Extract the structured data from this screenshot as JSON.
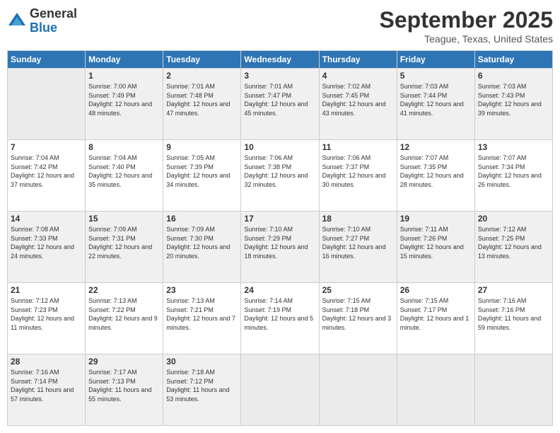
{
  "header": {
    "logo_general": "General",
    "logo_blue": "Blue",
    "month_title": "September 2025",
    "location": "Teague, Texas, United States"
  },
  "days_of_week": [
    "Sunday",
    "Monday",
    "Tuesday",
    "Wednesday",
    "Thursday",
    "Friday",
    "Saturday"
  ],
  "weeks": [
    [
      {
        "day": "",
        "empty": true
      },
      {
        "day": "1",
        "sunrise": "7:00 AM",
        "sunset": "7:49 PM",
        "daylight": "12 hours and 48 minutes."
      },
      {
        "day": "2",
        "sunrise": "7:01 AM",
        "sunset": "7:48 PM",
        "daylight": "12 hours and 47 minutes."
      },
      {
        "day": "3",
        "sunrise": "7:01 AM",
        "sunset": "7:47 PM",
        "daylight": "12 hours and 45 minutes."
      },
      {
        "day": "4",
        "sunrise": "7:02 AM",
        "sunset": "7:45 PM",
        "daylight": "12 hours and 43 minutes."
      },
      {
        "day": "5",
        "sunrise": "7:03 AM",
        "sunset": "7:44 PM",
        "daylight": "12 hours and 41 minutes."
      },
      {
        "day": "6",
        "sunrise": "7:03 AM",
        "sunset": "7:43 PM",
        "daylight": "12 hours and 39 minutes."
      }
    ],
    [
      {
        "day": "7",
        "sunrise": "7:04 AM",
        "sunset": "7:42 PM",
        "daylight": "12 hours and 37 minutes."
      },
      {
        "day": "8",
        "sunrise": "7:04 AM",
        "sunset": "7:40 PM",
        "daylight": "12 hours and 35 minutes."
      },
      {
        "day": "9",
        "sunrise": "7:05 AM",
        "sunset": "7:39 PM",
        "daylight": "12 hours and 34 minutes."
      },
      {
        "day": "10",
        "sunrise": "7:06 AM",
        "sunset": "7:38 PM",
        "daylight": "12 hours and 32 minutes."
      },
      {
        "day": "11",
        "sunrise": "7:06 AM",
        "sunset": "7:37 PM",
        "daylight": "12 hours and 30 minutes."
      },
      {
        "day": "12",
        "sunrise": "7:07 AM",
        "sunset": "7:35 PM",
        "daylight": "12 hours and 28 minutes."
      },
      {
        "day": "13",
        "sunrise": "7:07 AM",
        "sunset": "7:34 PM",
        "daylight": "12 hours and 26 minutes."
      }
    ],
    [
      {
        "day": "14",
        "sunrise": "7:08 AM",
        "sunset": "7:33 PM",
        "daylight": "12 hours and 24 minutes."
      },
      {
        "day": "15",
        "sunrise": "7:09 AM",
        "sunset": "7:31 PM",
        "daylight": "12 hours and 22 minutes."
      },
      {
        "day": "16",
        "sunrise": "7:09 AM",
        "sunset": "7:30 PM",
        "daylight": "12 hours and 20 minutes."
      },
      {
        "day": "17",
        "sunrise": "7:10 AM",
        "sunset": "7:29 PM",
        "daylight": "12 hours and 18 minutes."
      },
      {
        "day": "18",
        "sunrise": "7:10 AM",
        "sunset": "7:27 PM",
        "daylight": "12 hours and 16 minutes."
      },
      {
        "day": "19",
        "sunrise": "7:11 AM",
        "sunset": "7:26 PM",
        "daylight": "12 hours and 15 minutes."
      },
      {
        "day": "20",
        "sunrise": "7:12 AM",
        "sunset": "7:25 PM",
        "daylight": "12 hours and 13 minutes."
      }
    ],
    [
      {
        "day": "21",
        "sunrise": "7:12 AM",
        "sunset": "7:23 PM",
        "daylight": "12 hours and 11 minutes."
      },
      {
        "day": "22",
        "sunrise": "7:13 AM",
        "sunset": "7:22 PM",
        "daylight": "12 hours and 9 minutes."
      },
      {
        "day": "23",
        "sunrise": "7:13 AM",
        "sunset": "7:21 PM",
        "daylight": "12 hours and 7 minutes."
      },
      {
        "day": "24",
        "sunrise": "7:14 AM",
        "sunset": "7:19 PM",
        "daylight": "12 hours and 5 minutes."
      },
      {
        "day": "25",
        "sunrise": "7:15 AM",
        "sunset": "7:18 PM",
        "daylight": "12 hours and 3 minutes."
      },
      {
        "day": "26",
        "sunrise": "7:15 AM",
        "sunset": "7:17 PM",
        "daylight": "12 hours and 1 minute."
      },
      {
        "day": "27",
        "sunrise": "7:16 AM",
        "sunset": "7:16 PM",
        "daylight": "11 hours and 59 minutes."
      }
    ],
    [
      {
        "day": "28",
        "sunrise": "7:16 AM",
        "sunset": "7:14 PM",
        "daylight": "11 hours and 57 minutes."
      },
      {
        "day": "29",
        "sunrise": "7:17 AM",
        "sunset": "7:13 PM",
        "daylight": "11 hours and 55 minutes."
      },
      {
        "day": "30",
        "sunrise": "7:18 AM",
        "sunset": "7:12 PM",
        "daylight": "11 hours and 53 minutes."
      },
      {
        "day": "",
        "empty": true
      },
      {
        "day": "",
        "empty": true
      },
      {
        "day": "",
        "empty": true
      },
      {
        "day": "",
        "empty": true
      }
    ]
  ],
  "labels": {
    "sunrise_prefix": "Sunrise: ",
    "sunset_prefix": "Sunset: ",
    "daylight_prefix": "Daylight: "
  }
}
